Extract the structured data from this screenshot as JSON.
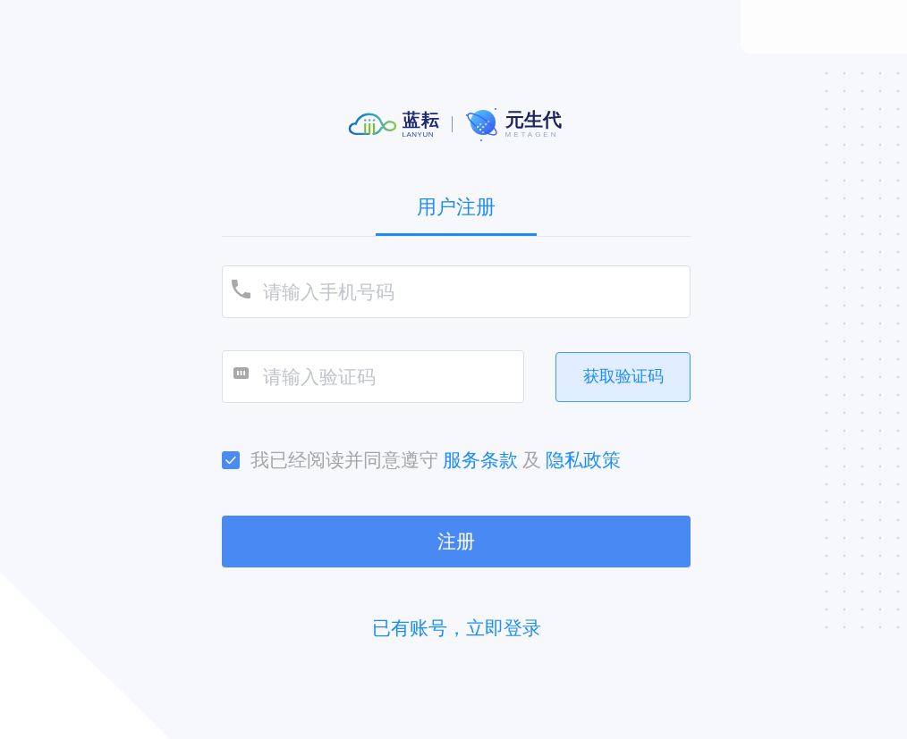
{
  "logo": {
    "brands": [
      {
        "kind": "cloud",
        "name": "蓝耘",
        "subtitle": "LANYUN"
      },
      {
        "kind": "planet",
        "name": "元生代",
        "subtitle": "METAGEN"
      }
    ]
  },
  "tabs": [
    {
      "label": "用户注册",
      "selected": true
    }
  ],
  "form": {
    "phone_field": {
      "placeholder": "请输入手机号码"
    },
    "code_field": {
      "placeholder": "请输入验证码"
    },
    "code_button": {
      "label": "获取验证码"
    },
    "agreement": {
      "checked": true,
      "parts": [
        {
          "kind": "text",
          "text": "我已经阅读并同意遵守"
        },
        {
          "kind": "link",
          "text": "服务条款"
        },
        {
          "kind": "text",
          "text": "及"
        },
        {
          "kind": "link",
          "text": "隐私政策"
        }
      ]
    },
    "submit_button": {
      "label": "注册"
    },
    "login_link": {
      "label": "已有账号，立即登录"
    }
  }
}
